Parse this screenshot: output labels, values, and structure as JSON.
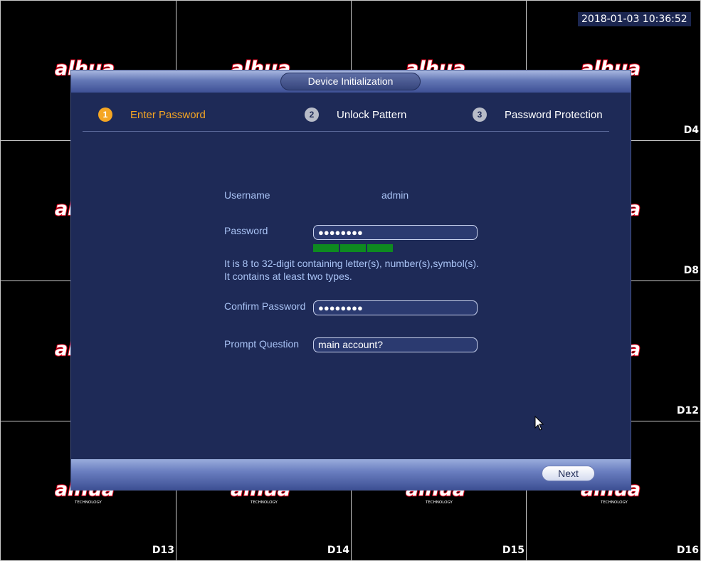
{
  "clock": "2018-01-03 10:36:52",
  "channels": [
    "D4",
    "D8",
    "D12",
    "D13",
    "D14",
    "D15",
    "D16"
  ],
  "brand": {
    "name": "alhua",
    "tagline": "TECHNOLOGY",
    "accent": "#e0001b"
  },
  "dialog": {
    "title": "Device Initialization",
    "steps": [
      {
        "number": "1",
        "label": "Enter Password",
        "active": true
      },
      {
        "number": "2",
        "label": "Unlock Pattern",
        "active": false
      },
      {
        "number": "3",
        "label": "Password Protection",
        "active": false
      }
    ],
    "form": {
      "username_label": "Username",
      "username_value": "admin",
      "password_label": "Password",
      "password_value": "●●●●●●●●",
      "password_strength_segments": 3,
      "hint": "It is 8 to 32-digit containing letter(s), number(s),symbol(s). It contains at least two types.",
      "confirm_label": "Confirm Password",
      "confirm_value": "●●●●●●●●",
      "prompt_label": "Prompt Question",
      "prompt_value": "main account?"
    },
    "next_label": "Next"
  },
  "colors": {
    "dialog_bg": "#1e2a57",
    "active_step": "#f5a623",
    "label_text": "#a9c3f5",
    "strength_bar": "#0e8a20"
  }
}
